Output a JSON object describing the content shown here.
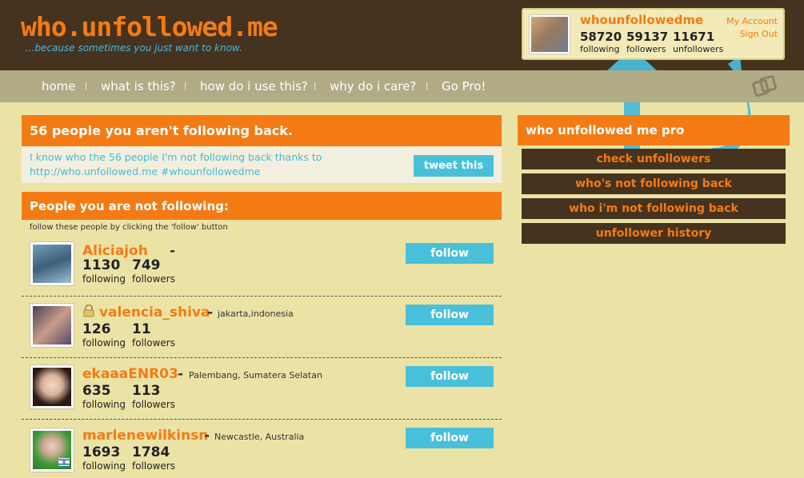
{
  "header": {
    "logo": "who.unfollowed.me",
    "tagline": "...because sometimes you just want to know."
  },
  "account": {
    "username": "whounfollowedme",
    "following": "58720",
    "following_label": "following",
    "followers": "59137",
    "followers_label": "followers",
    "unfollowers": "11671",
    "unfollowers_label": "unfollowers",
    "my_account": "My Account",
    "sign_out": "Sign Out"
  },
  "nav": {
    "items": [
      {
        "label": "home"
      },
      {
        "label": "what is this?"
      },
      {
        "label": "how do i use this?"
      },
      {
        "label": "why do i care?"
      },
      {
        "label": "Go Pro!"
      }
    ],
    "separator": "|"
  },
  "summary": {
    "title": "56 people you aren't following back.",
    "tweet_text": "I know who the 56 people I'm not following back thanks to http://who.unfollowed.me #whounfollowedme",
    "tweet_button": "tweet this"
  },
  "not_following": {
    "title": "People you are not following:",
    "hint": "follow these people by clicking the 'follow' button",
    "follow_label": "follow",
    "dash": "-",
    "following_label": "following",
    "followers_label": "followers",
    "users": [
      {
        "name": "Aliciajoh",
        "location": "",
        "following": "1130",
        "followers": "749",
        "locked": false,
        "flag": false
      },
      {
        "name": "valencia_shiva",
        "location": "jakarta,indonesia",
        "following": "126",
        "followers": "11",
        "locked": true,
        "flag": false
      },
      {
        "name": "ekaaaENR03",
        "location": "Palembang, Sumatera Selatan",
        "following": "635",
        "followers": "113",
        "locked": false,
        "flag": false
      },
      {
        "name": "marlenewilkinsn",
        "location": "Newcastle, Australia",
        "following": "1693",
        "followers": "1784",
        "locked": false,
        "flag": true
      }
    ]
  },
  "pro": {
    "title": "who unfollowed me pro",
    "items": [
      {
        "label": "check unfollowers"
      },
      {
        "label": "who's not following back"
      },
      {
        "label": "who i'm not following back"
      },
      {
        "label": "unfollower history"
      }
    ]
  },
  "colors": {
    "accent_orange": "#f47b13",
    "dark_brown": "#46331f",
    "button_blue": "#49c0da",
    "background": "#ebe3a6",
    "nav_bar": "#b1ab86"
  },
  "icons": [
    "lock-icon",
    "flag-icon",
    "nav-toggle-icon",
    "arrow-decoration"
  ]
}
